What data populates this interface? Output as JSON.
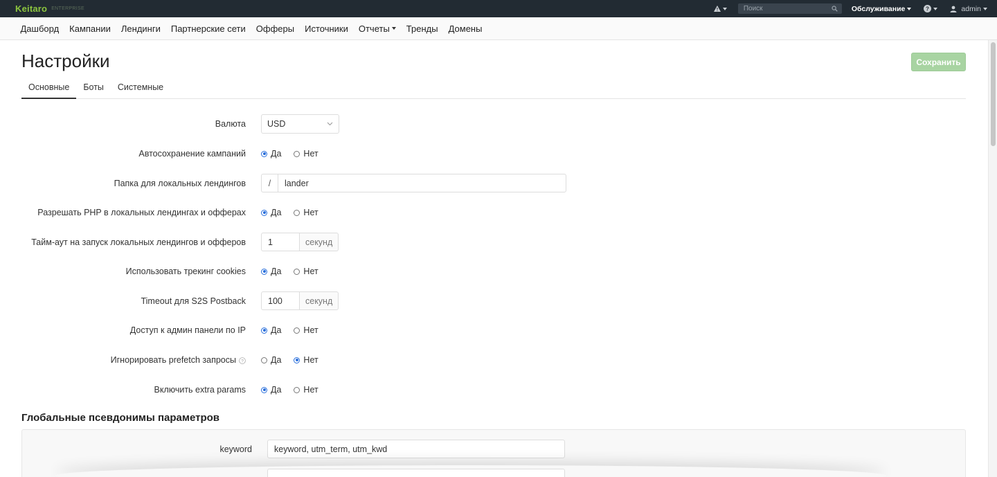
{
  "topbar": {
    "brand": "Keitaro",
    "brand_sub": "ENTERPRISE",
    "search_placeholder": "Поиск",
    "maintenance": "Обслуживание",
    "user": "admin"
  },
  "nav": {
    "items": [
      "Дашборд",
      "Кампании",
      "Лендинги",
      "Партнерские сети",
      "Офферы",
      "Источники",
      "Отчеты",
      "Тренды",
      "Домены"
    ]
  },
  "page": {
    "title": "Настройки",
    "save_label": "Сохранить",
    "tabs": [
      "Основные",
      "Боты",
      "Системные"
    ]
  },
  "form": {
    "currency_label": "Валюта",
    "currency_value": "USD",
    "autosave_label": "Автосохранение кампаний",
    "lander_folder_label": "Папка для локальных лендингов",
    "lander_folder_prefix": "/",
    "lander_folder_value": "lander",
    "php_label": "Разрешать PHP в локальных лендингах и офферах",
    "timeout_label": "Тайм-аут на запуск локальных лендингов и офферов",
    "timeout_value": "1",
    "timeout_unit": "секунд",
    "cookies_label": "Использовать трекинг cookies",
    "s2s_label": "Timeout для S2S Postback",
    "s2s_value": "100",
    "s2s_unit": "секунд",
    "admin_ip_label": "Доступ к админ панели по IP",
    "prefetch_label": "Игнорировать prefetch запросы",
    "extra_params_label": "Включить extra params",
    "yes": "Да",
    "no": "Нет"
  },
  "aliases": {
    "title": "Глобальные псевдонимы параметров",
    "keyword_label": "keyword",
    "keyword_value": "keyword, utm_term, utm_kwd"
  },
  "colors": {
    "topbar": "#222b33",
    "brand": "#8cc63f",
    "save_button": "#a8d4a2",
    "radio_checked": "#2a6fdb"
  }
}
